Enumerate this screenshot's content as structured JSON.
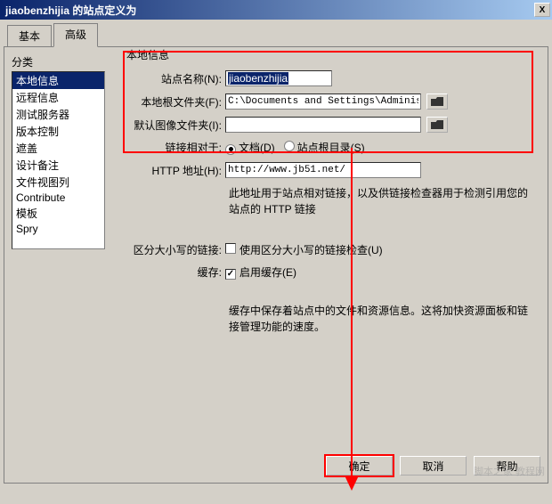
{
  "window": {
    "title": "jiaobenzhijia 的站点定义为",
    "close": "X"
  },
  "tabs": {
    "basic": "基本",
    "advanced": "高级"
  },
  "category": {
    "label": "分类",
    "items": [
      "本地信息",
      "远程信息",
      "测试服务器",
      "版本控制",
      "遮盖",
      "设计备注",
      "文件视图列",
      "Contribute",
      "模板",
      "Spry"
    ]
  },
  "section": {
    "legend": "本地信息"
  },
  "fields": {
    "site_name": {
      "label": "站点名称(N):",
      "value": "jiaobenzhijia"
    },
    "local_root": {
      "label": "本地根文件夹(F):",
      "value": "C:\\Documents and Settings\\Administrato"
    },
    "default_img": {
      "label": "默认图像文件夹(I):",
      "value": ""
    },
    "links_rel": {
      "label": "链接相对于:",
      "opt1": "文档(D)",
      "opt2": "站点根目录(S)"
    },
    "http_addr": {
      "label": "HTTP 地址(H):",
      "value": "http://www.jb51.net/"
    },
    "http_info": "此地址用于站点相对链接，以及供链接检查器用于检测引用您的站点的 HTTP 链接",
    "case_links": {
      "label": "区分大小写的链接:",
      "text": "使用区分大小写的链接检查(U)"
    },
    "cache": {
      "label": "缓存:",
      "text": "启用缓存(E)"
    },
    "cache_info": "缓存中保存着站点中的文件和资源信息。这将加快资源面板和链接管理功能的速度。"
  },
  "buttons": {
    "ok": "确定",
    "cancel": "取消",
    "help": "帮助"
  },
  "watermark": "脚本之家 教程网"
}
